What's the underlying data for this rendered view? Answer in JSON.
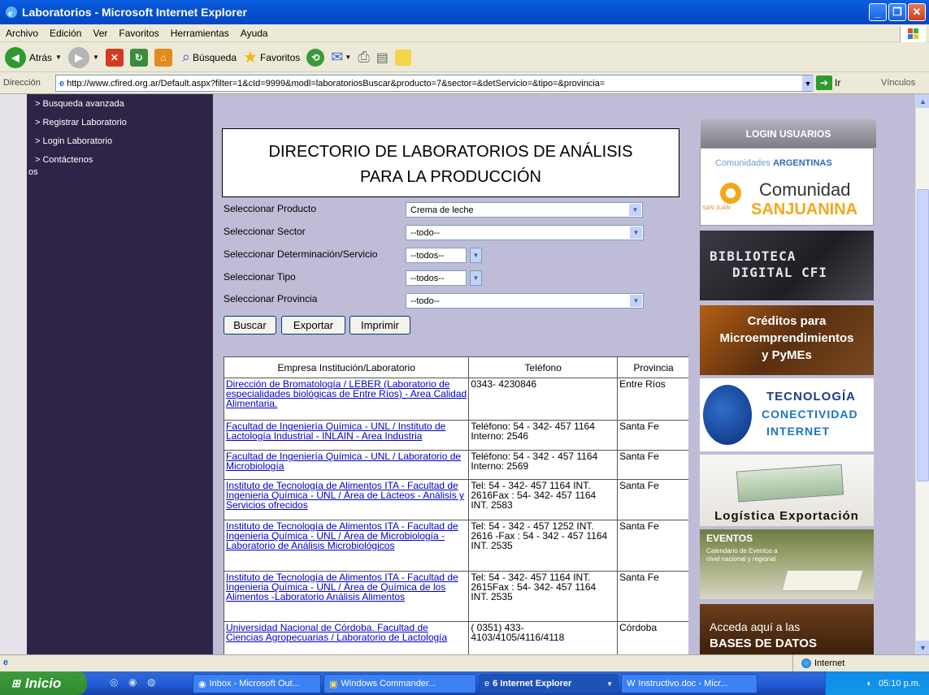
{
  "window": {
    "title": "Laboratorios - Microsoft Internet Explorer"
  },
  "menu": [
    "Archivo",
    "Edición",
    "Ver",
    "Favoritos",
    "Herramientas",
    "Ayuda"
  ],
  "toolbar": {
    "back": "Atrás",
    "search": "Búsqueda",
    "favorites": "Favoritos"
  },
  "address": {
    "label": "Dirección",
    "url": "http://www.cfired.org.ar/Default.aspx?filter=1&cId=9999&modl=laboratoriosBuscar&producto=7&sector=&detServicio=&tipo=&provincia=",
    "go": "Ir",
    "links": "Vínculos"
  },
  "leftnav": {
    "items": [
      "> Busqueda avanzada",
      "> Registrar Laboratorio",
      "> Login Laboratorio",
      "> Contáctenos"
    ],
    "fragment": "os"
  },
  "page": {
    "title_line1": "DIRECTORIO DE LABORATORIOS DE ANÁLISIS",
    "title_line2": "PARA LA PRODUCCIÓN"
  },
  "form": {
    "producto_label": "Seleccionar Producto",
    "producto_value": "Crema de leche",
    "sector_label": "Seleccionar Sector",
    "sector_value": "--todo--",
    "servicio_label": "Seleccionar Determinación/Servicio",
    "servicio_value": "--todos--",
    "tipo_label": "Seleccionar Tipo",
    "tipo_value": "--todos--",
    "provincia_label": "Seleccionar Provincia",
    "provincia_value": "--todo--",
    "buscar": "Buscar",
    "exportar": "Exportar",
    "imprimir": "Imprimir"
  },
  "results": {
    "headers": [
      "Empresa Institución/Laboratorio",
      "Teléfono",
      "Provincia"
    ],
    "rows": [
      {
        "name": "Dirección de Bromatología / LEBER (Laboratorio de especialidades biológicas de Entre Ríos) - Area Calidad Alimentaria.",
        "phone": "0343- 4230846",
        "prov": "Entre Ríos"
      },
      {
        "name": "Facultad de Ingeniería Química - UNL / Instituto de Lactología Industrial - INLAIN - Area Industria",
        "phone": "Teléfono: 54 - 342- 457 1164 Interno: 2546",
        "prov": "Santa Fe"
      },
      {
        "name": "Facultad de Ingeniería Química - UNL / Laboratorio de Microbiología",
        "phone": "Teléfono: 54 - 342 - 457 1164 Interno: 2569",
        "prov": "Santa Fe"
      },
      {
        "name": "Instituto de Tecnología de Alimentos ITA - Facultad de Ingenieria Química - UNL / Área de Lácteos - Análisis y Servicios ofrecidos",
        "phone": "Tel: 54 - 342- 457 1164 INT. 2616Fax : 54- 342- 457 1164 INT. 2583",
        "prov": "Santa Fe"
      },
      {
        "name": "Instituto de Tecnología de Alimentos ITA - Facultad de Ingenieria Química - UNL / Área de Microbiología - Laboratorio de Análisis Microbiológicos",
        "phone": "Tel: 54 - 342 - 457 1252 INT. 2616 -Fax : 54 - 342 - 457 1164 INT. 2535",
        "prov": "Santa Fe"
      },
      {
        "name": "Instituto de Tecnología de Alimentos ITA - Facultad de Ingenieria Química - UNL / Área de Química de los Alimentos -Laboratorio Análisis Alimentos",
        "phone": "Tel: 54 - 342- 457 1164 INT. 2615Fax : 54- 342- 457 1164 INT. 2535",
        "prov": "Santa Fe"
      },
      {
        "name": "Universidad Nacional de Córdoba. Facultad de Ciencias Agropecuarias / Laboratorio de Lactología",
        "phone": "( 0351) 433-4103/4105/4116/4118",
        "prov": "Córdoba"
      }
    ]
  },
  "sidebar": {
    "login": "LOGIN USUARIOS",
    "comunidades_a": "Comunidades",
    "comunidades_b": "ARGENTINAS",
    "comunidad_1": "Comunidad",
    "comunidad_2": "SANJUANINA",
    "sanjuan": "SAN JUAN",
    "biblio_1": "BIBLIOTECA",
    "biblio_2": "DIGITAL CFI",
    "creditos_1": "Créditos para",
    "creditos_2": "Microemprendimientos",
    "creditos_3": "y PyMEs",
    "tec_1": "TECNOLOGÍA",
    "tec_2": "CONECTIVIDAD",
    "tec_3": "INTERNET",
    "logistica": "Logística Exportación",
    "eventos": "EVENTOS",
    "eventos_sub": "Calendario de Eventos a nivel nacional y regional",
    "acceda_1": "Acceda aquí a las",
    "acceda_2": "BASES DE DATOS"
  },
  "status": {
    "zone": "Internet"
  },
  "taskbar": {
    "start": "Inicio",
    "tasks": [
      "Inbox - Microsoft Out...",
      "Windows Commander...",
      "6 Internet Explorer",
      "Instructivo.doc - Micr..."
    ],
    "clock": "05:10 p.m."
  },
  "colors": {
    "titlebar": "#0751d0",
    "page_bg": "#bfbcd8",
    "nav_bg": "#2d2448",
    "link": "#0000cc",
    "taskbar": "#245edb",
    "start": "#3c9b3c"
  }
}
